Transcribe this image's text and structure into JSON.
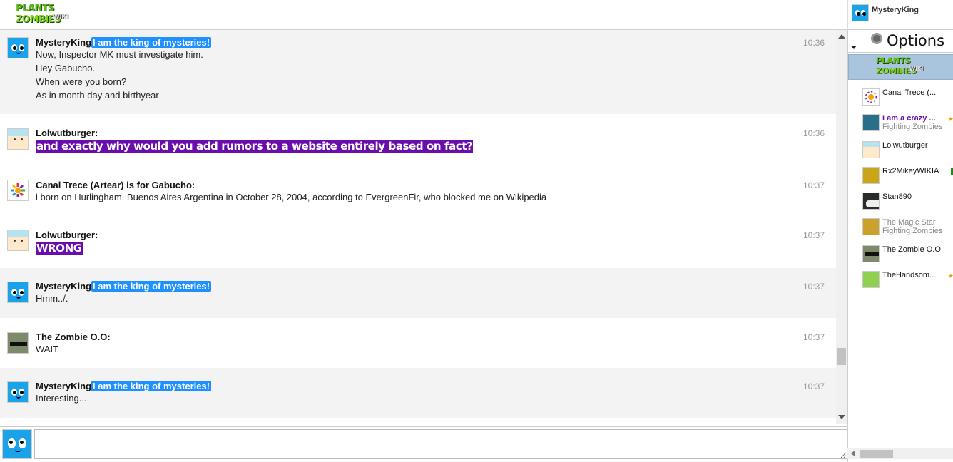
{
  "logo": {
    "line1": "PLANTS",
    "line2": "ZOMBIES",
    "line3": "WIKI"
  },
  "current_user": {
    "name": "MysteryKing"
  },
  "messages": [
    {
      "user": "MysteryKing",
      "tag": "I am the king of mysteries!",
      "time": "10:36",
      "lines": [
        "Now, Inspector MK must investigate him.",
        "Hey Gabucho.",
        "When were you born?",
        "As in month day and birthyear"
      ]
    },
    {
      "user": "Lolwutburger:",
      "time": "10:36",
      "highlight": "and exactly why would you add rumors to a website entirely based on fact?"
    },
    {
      "user": "Canal Trece (Artear) is for Gabucho:",
      "time": "10:37",
      "lines": [
        "i born on Hurlingham, Buenos Aires Argentina in October 28, 2004, according to EvergreenFir, who blocked me on Wikipedia"
      ]
    },
    {
      "user": "Lolwutburger:",
      "time": "10:37",
      "highlight": "WRONG"
    },
    {
      "user": "MysteryKing",
      "tag": "I am the king of mysteries!",
      "time": "10:37",
      "lines": [
        "Hmm../."
      ]
    },
    {
      "user": "The Zombie O.O:",
      "time": "10:37",
      "lines": [
        "WAIT"
      ]
    },
    {
      "user": "MysteryKing",
      "tag": "I am the king of mysteries!",
      "time": "10:37",
      "lines": [
        "Interesting..."
      ]
    }
  ],
  "input": {
    "value": ""
  },
  "sidebar": {
    "options_label": "Options",
    "users": [
      {
        "name": "Canal Trece (...",
        "sub": ""
      },
      {
        "name": "I am a crazy ...",
        "sub": "Fighting Zombies"
      },
      {
        "name": "Lolwutburger",
        "sub": ""
      },
      {
        "name": "Rx2MikeyWIKIA",
        "sub": ""
      },
      {
        "name": "Stan890",
        "sub": ""
      },
      {
        "name": "The Magic Star",
        "sub": "Fighting Zombies"
      },
      {
        "name": "The Zombie O.O",
        "sub": ""
      },
      {
        "name": "TheHandsom...",
        "sub": ""
      }
    ]
  },
  "colors": {
    "tag_blue": "#1e90ff",
    "highlight_purple": "#6a0dad",
    "alt_row": "#f3f3f3"
  }
}
